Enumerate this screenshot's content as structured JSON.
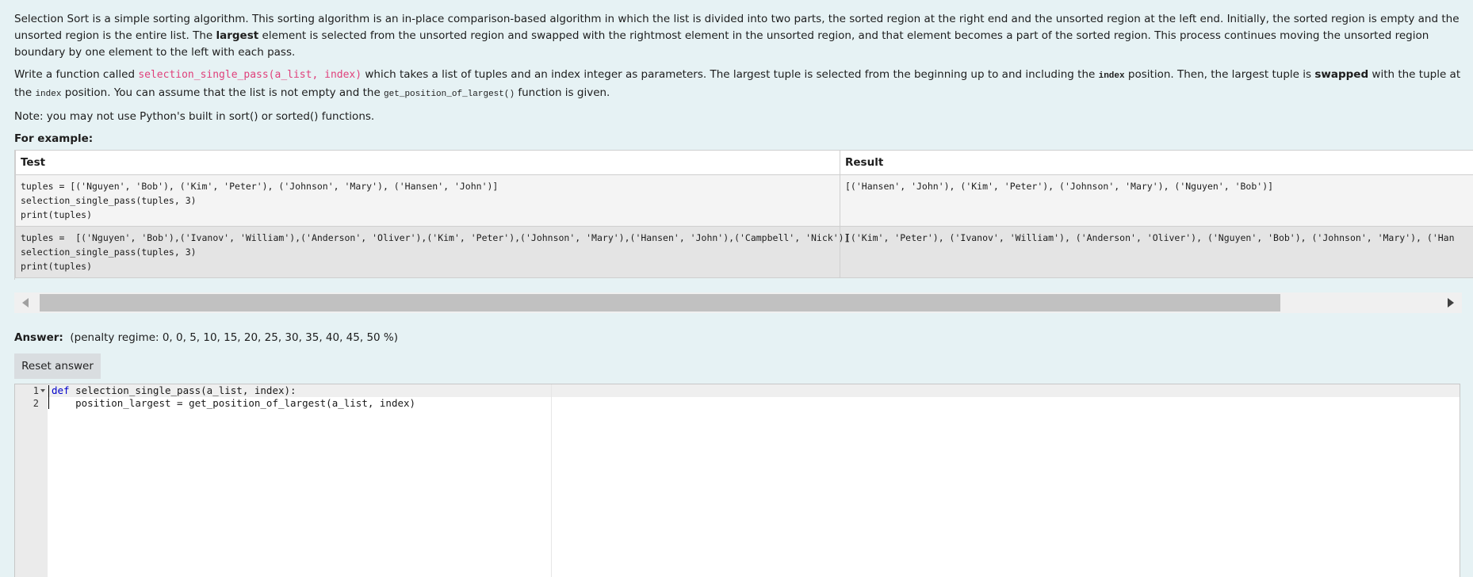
{
  "question": {
    "p1_a": "Selection Sort is a simple sorting algorithm. This sorting algorithm is an in-place comparison-based algorithm in which the list is divided into two parts, the sorted region at the right end and the unsorted region at the left end. Initially, the sorted region is empty and the unsorted region is the entire list. The ",
    "p1_bold": "largest",
    "p1_b": " element is selected from the unsorted region and swapped with the rightmost element in the unsorted region, and that element becomes a part of the sorted region. This process continues moving the unsorted region boundary by one element to the left with each pass.",
    "p2_a": "Write a function called ",
    "p2_code": "selection_single_pass(a_list, index)",
    "p2_b": " which takes a list of tuples and an index integer as parameters. The largest tuple is selected from the beginning up to and including the ",
    "p2_index1": "index",
    "p2_c": " position. Then, the largest tuple is ",
    "p2_bold": "swapped",
    "p2_d": " with the tuple at the ",
    "p2_index2": "index",
    "p2_e": " position. You can assume that the list is not empty and the ",
    "p2_func": "get_position_of_largest()",
    "p2_f": " function is given.",
    "p3": "Note: you may not use Python's built in sort() or sorted() functions.",
    "for_example": "For example:"
  },
  "examples": {
    "headers": [
      "Test",
      "Result"
    ],
    "rows": [
      {
        "test": "tuples = [('Nguyen', 'Bob'), ('Kim', 'Peter'), ('Johnson', 'Mary'), ('Hansen', 'John')]\nselection_single_pass(tuples, 3)\nprint(tuples)",
        "result": "[('Hansen', 'John'), ('Kim', 'Peter'), ('Johnson', 'Mary'), ('Nguyen', 'Bob')]"
      },
      {
        "test": "tuples =  [('Nguyen', 'Bob'),('Ivanov', 'William'),('Anderson', 'Oliver'),('Kim', 'Peter'),('Johnson', 'Mary'),('Hansen', 'John'),('Campbell', 'Nick')]\nselection_single_pass(tuples, 3)\nprint(tuples)",
        "result": "[('Kim', 'Peter'), ('Ivanov', 'William'), ('Anderson', 'Oliver'), ('Nguyen', 'Bob'), ('Johnson', 'Mary'), ('Han"
      }
    ]
  },
  "answer": {
    "label": "Answer:",
    "penalty": "(penalty regime: 0, 0, 5, 10, 15, 20, 25, 30, 35, 40, 45, 50 %)",
    "reset_label": "Reset answer"
  },
  "editor": {
    "lines": [
      {
        "num": "1",
        "kw": "def",
        "text": " selection_single_pass(a_list, index):"
      },
      {
        "num": "2",
        "kw": "",
        "text": "    position_largest = get_position_of_largest(a_list, index)"
      }
    ]
  },
  "icons": {
    "scroll_left": "arrow-left-icon",
    "scroll_right": "arrow-right-icon",
    "fold": "fold-arrow-icon"
  }
}
